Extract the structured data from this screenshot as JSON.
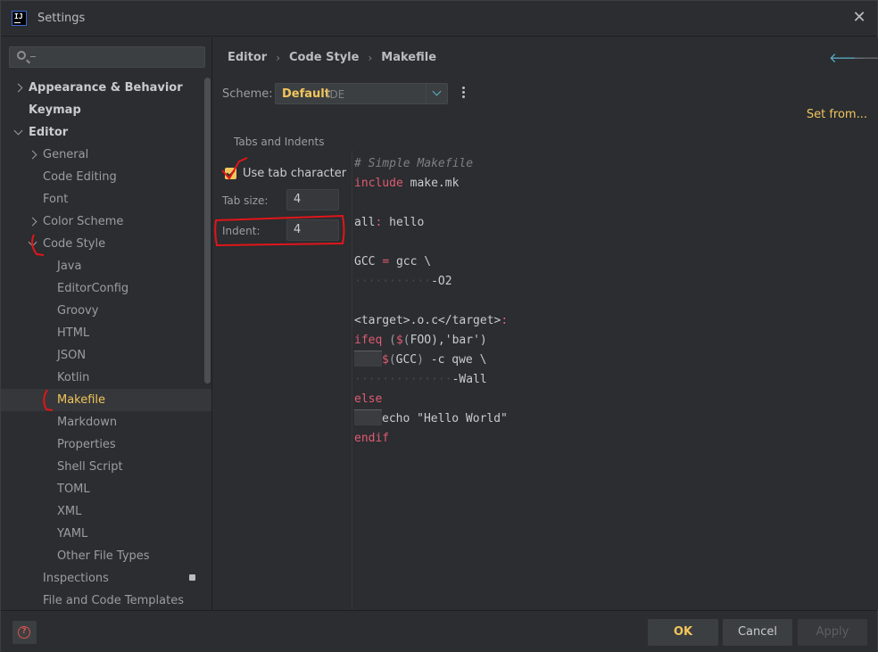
{
  "window": {
    "logo_text": "IJ",
    "title": "Settings",
    "close_glyph": "✕"
  },
  "sidebar": {
    "search": {
      "value": "",
      "placeholder": ""
    },
    "items": [
      {
        "label": "Appearance & Behavior",
        "level": 0,
        "expander": "collapsed",
        "bold": true
      },
      {
        "label": "Keymap",
        "level": 0,
        "expander": "none",
        "bold": true
      },
      {
        "label": "Editor",
        "level": 0,
        "expander": "expanded",
        "bold": true
      },
      {
        "label": "General",
        "level": 1,
        "expander": "collapsed"
      },
      {
        "label": "Code Editing",
        "level": 1,
        "expander": "none"
      },
      {
        "label": "Font",
        "level": 1,
        "expander": "none"
      },
      {
        "label": "Color Scheme",
        "level": 1,
        "expander": "collapsed"
      },
      {
        "label": "Code Style",
        "level": 1,
        "expander": "expanded"
      },
      {
        "label": "Java",
        "level": 2,
        "expander": "none"
      },
      {
        "label": "EditorConfig",
        "level": 2,
        "expander": "none"
      },
      {
        "label": "Groovy",
        "level": 2,
        "expander": "none"
      },
      {
        "label": "HTML",
        "level": 2,
        "expander": "none"
      },
      {
        "label": "JSON",
        "level": 2,
        "expander": "none"
      },
      {
        "label": "Kotlin",
        "level": 2,
        "expander": "none"
      },
      {
        "label": "Makefile",
        "level": 2,
        "expander": "none",
        "selected": true
      },
      {
        "label": "Markdown",
        "level": 2,
        "expander": "none"
      },
      {
        "label": "Properties",
        "level": 2,
        "expander": "none"
      },
      {
        "label": "Shell Script",
        "level": 2,
        "expander": "none"
      },
      {
        "label": "TOML",
        "level": 2,
        "expander": "none"
      },
      {
        "label": "XML",
        "level": 2,
        "expander": "none"
      },
      {
        "label": "YAML",
        "level": 2,
        "expander": "none"
      },
      {
        "label": "Other File Types",
        "level": 2,
        "expander": "none"
      },
      {
        "label": "Inspections",
        "level": 1,
        "expander": "none",
        "badge": true
      },
      {
        "label": "File and Code Templates",
        "level": 1,
        "expander": "none"
      }
    ]
  },
  "breadcrumb": [
    "Editor",
    "Code Style",
    "Makefile"
  ],
  "breadcrumb_separator": "›",
  "nav": {
    "back_glyph": "🡐",
    "forward_glyph": "🡒"
  },
  "scheme": {
    "label": "Scheme:",
    "value": "Default",
    "sub": "IDE",
    "set_from": "Set from..."
  },
  "tabs_indents": {
    "group_title": "Tabs and Indents",
    "use_tab_label": "Use tab character",
    "use_tab_checked": true,
    "tab_size_label": "Tab size:",
    "tab_size_value": "4",
    "indent_label": "Indent:",
    "indent_value": "4"
  },
  "code_preview": [
    [
      {
        "t": "# Simple Makefile",
        "c": "comment"
      }
    ],
    [
      {
        "t": "include",
        "c": "kw"
      },
      {
        "t": " make.mk",
        "c": "plain"
      }
    ],
    [],
    [
      {
        "t": "all",
        "c": "plain"
      },
      {
        "t": ":",
        "c": "kw"
      },
      {
        "t": " hello",
        "c": "plain"
      }
    ],
    [],
    [
      {
        "t": "GCC ",
        "c": "plain"
      },
      {
        "t": "=",
        "c": "kw"
      },
      {
        "t": " gcc \\",
        "c": "plain"
      }
    ],
    [
      {
        "t": "···········",
        "c": "ws"
      },
      {
        "t": "-O2",
        "c": "plain"
      }
    ],
    [],
    [
      {
        "t": "<target>.o.c</target>",
        "c": "plain"
      },
      {
        "t": ":",
        "c": "kw"
      }
    ],
    [
      {
        "t": "ifeq",
        "c": "kw"
      },
      {
        "t": " (",
        "c": "dim"
      },
      {
        "t": "$",
        "c": "kw"
      },
      {
        "t": "(",
        "c": "dim"
      },
      {
        "t": "FOO",
        "c": "plain"
      },
      {
        "t": "),'bar')",
        "c": "plain"
      }
    ],
    [
      {
        "t": "",
        "c": "tab"
      },
      {
        "t": "$",
        "c": "kw"
      },
      {
        "t": "(",
        "c": "dim"
      },
      {
        "t": "GCC",
        "c": "plain"
      },
      {
        "t": ")",
        "c": "dim"
      },
      {
        "t": " -c qwe \\",
        "c": "plain"
      }
    ],
    [
      {
        "t": "··············",
        "c": "ws"
      },
      {
        "t": "-Wall",
        "c": "plain"
      }
    ],
    [
      {
        "t": "else",
        "c": "kw"
      }
    ],
    [
      {
        "t": "",
        "c": "tab"
      },
      {
        "t": "echo \"Hello World\"",
        "c": "plain"
      }
    ],
    [
      {
        "t": "endif",
        "c": "kw"
      }
    ]
  ],
  "footer": {
    "help_glyph": "?",
    "ok_label": "OK",
    "cancel_label": "Cancel",
    "apply_label": "Apply"
  },
  "colors": {
    "background": "#2b2d30",
    "accent_yellow": "#f2c55c",
    "keyword_red": "#e05b74",
    "annotation_red": "#e1151a",
    "nav_blue": "#5ab0c8"
  },
  "icons": [
    "app-logo-icon",
    "close-icon",
    "search-icon",
    "chevron-right-icon",
    "chevron-down-icon",
    "back-arrow-icon",
    "forward-arrow-icon",
    "dropdown-chevron-icon",
    "more-options-icon",
    "checkmark-icon",
    "badge-icon",
    "help-icon"
  ]
}
